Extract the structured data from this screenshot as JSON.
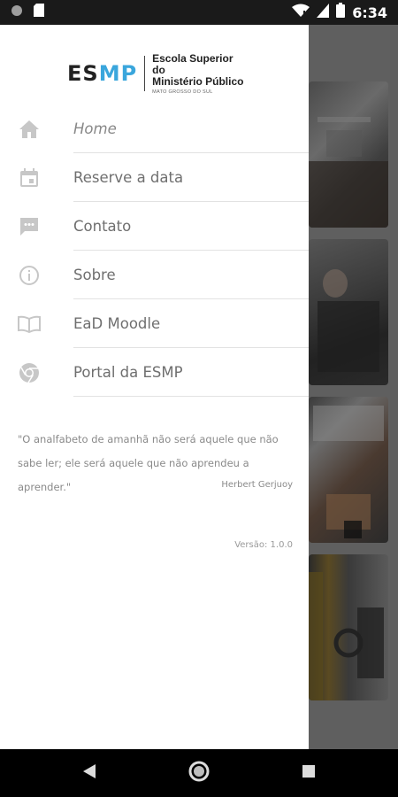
{
  "status_bar": {
    "time": "6:34"
  },
  "logo": {
    "mark_part1": "ES",
    "mark_part2": "MP",
    "line1": "Escola Superior do",
    "line2": "Ministério Público",
    "line3": "MATO GROSSO DO SUL",
    "accent_color": "#3aa6dc"
  },
  "menu": {
    "items": [
      {
        "label": "Home",
        "icon": "home-icon",
        "active": true
      },
      {
        "label": "Reserve a data",
        "icon": "calendar-icon"
      },
      {
        "label": "Contato",
        "icon": "chat-icon"
      },
      {
        "label": "Sobre",
        "icon": "info-icon"
      },
      {
        "label": "EaD Moodle",
        "icon": "book-icon"
      },
      {
        "label": "Portal da ESMP",
        "icon": "chrome-icon"
      }
    ]
  },
  "quote": {
    "text": "\"O analfabeto de amanhã não será aquele que não sabe ler; ele será aquele que não aprendeu a aprender.\"",
    "author": "Herbert Gerjuoy"
  },
  "version": "Versão: 1.0.0"
}
